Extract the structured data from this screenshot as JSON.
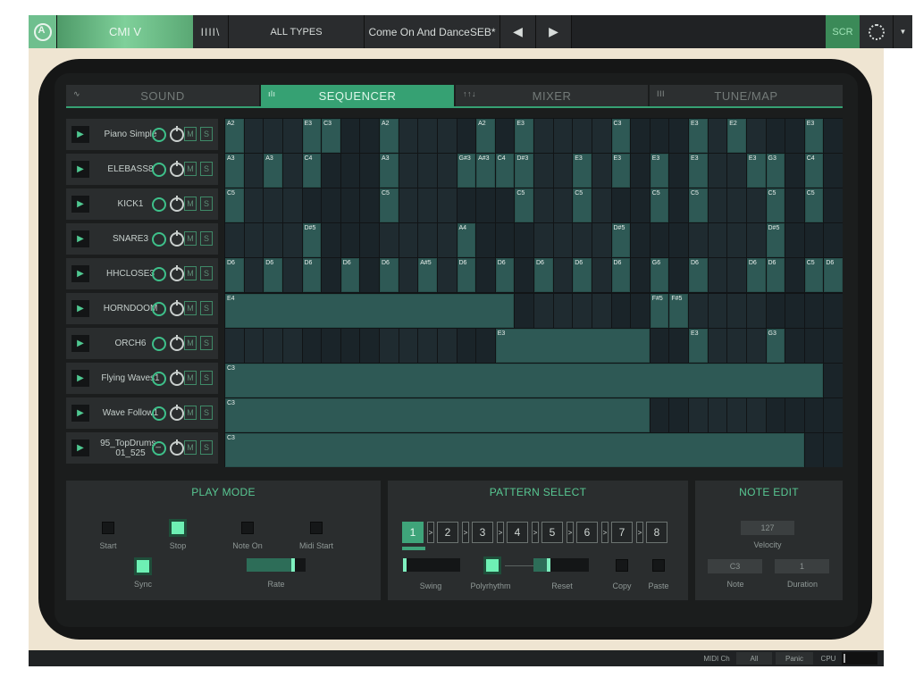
{
  "topbar": {
    "app_name": "CMI V",
    "library_icon": "IIII\\",
    "type_filter": "ALL TYPES",
    "preset_name": "Come On And DanceSEB*",
    "prev_glyph": "◀",
    "next_glyph": "▶",
    "scr_label": "SCR",
    "menu_glyph": "▼"
  },
  "tabs": [
    {
      "label": "SOUND",
      "icon": "∿"
    },
    {
      "label": "SEQUENCER",
      "icon": "ılı"
    },
    {
      "label": "MIXER",
      "icon": "↑↑↓"
    },
    {
      "label": "TUNE/MAP",
      "icon": "III"
    }
  ],
  "tracks": [
    {
      "name": "Piano Simple"
    },
    {
      "name": "ELEBASS8"
    },
    {
      "name": "KICK1"
    },
    {
      "name": "SNARE3"
    },
    {
      "name": "HHCLOSE3"
    },
    {
      "name": "HORNDOOM"
    },
    {
      "name": "ORCH6"
    },
    {
      "name": "Flying Waves1"
    },
    {
      "name": "Wave Follow1"
    },
    {
      "name": "95_TopDrums_ 01_525"
    }
  ],
  "track_controls": {
    "play_glyph": "▶",
    "mute": "M",
    "solo": "S"
  },
  "grid": {
    "steps": 32,
    "rows": [
      {
        "notes": [
          {
            "s": 0,
            "l": 1,
            "n": "A2"
          },
          {
            "s": 4,
            "l": 1,
            "n": "E3"
          },
          {
            "s": 5,
            "l": 1,
            "n": "C3"
          },
          {
            "s": 8,
            "l": 1,
            "n": "A2"
          },
          {
            "s": 13,
            "l": 1,
            "n": "A2"
          },
          {
            "s": 15,
            "l": 1,
            "n": "E3"
          },
          {
            "s": 20,
            "l": 1,
            "n": "C3"
          },
          {
            "s": 24,
            "l": 1,
            "n": "E3"
          },
          {
            "s": 26,
            "l": 1,
            "n": "E2"
          },
          {
            "s": 30,
            "l": 1,
            "n": "E3"
          }
        ]
      },
      {
        "notes": [
          {
            "s": 0,
            "l": 1,
            "n": "A3"
          },
          {
            "s": 2,
            "l": 1,
            "n": "A3"
          },
          {
            "s": 4,
            "l": 1,
            "n": "C4"
          },
          {
            "s": 8,
            "l": 1,
            "n": "A3"
          },
          {
            "s": 12,
            "l": 1,
            "n": "G#3"
          },
          {
            "s": 13,
            "l": 1,
            "n": "A#3"
          },
          {
            "s": 14,
            "l": 1,
            "n": "C4"
          },
          {
            "s": 15,
            "l": 1,
            "n": "D#3"
          },
          {
            "s": 18,
            "l": 1,
            "n": "E3"
          },
          {
            "s": 20,
            "l": 1,
            "n": "E3"
          },
          {
            "s": 22,
            "l": 1,
            "n": "E3"
          },
          {
            "s": 24,
            "l": 1,
            "n": "E3"
          },
          {
            "s": 27,
            "l": 1,
            "n": "E3"
          },
          {
            "s": 28,
            "l": 1,
            "n": "G3"
          },
          {
            "s": 30,
            "l": 1,
            "n": "C4"
          }
        ]
      },
      {
        "notes": [
          {
            "s": 0,
            "l": 1,
            "n": "C5"
          },
          {
            "s": 8,
            "l": 1,
            "n": "C5"
          },
          {
            "s": 15,
            "l": 1,
            "n": "C5"
          },
          {
            "s": 18,
            "l": 1,
            "n": "C5"
          },
          {
            "s": 22,
            "l": 1,
            "n": "C5"
          },
          {
            "s": 24,
            "l": 1,
            "n": "C5"
          },
          {
            "s": 28,
            "l": 1,
            "n": "C5"
          },
          {
            "s": 30,
            "l": 1,
            "n": "C5"
          }
        ]
      },
      {
        "notes": [
          {
            "s": 4,
            "l": 1,
            "n": "D#5"
          },
          {
            "s": 12,
            "l": 1,
            "n": "A4"
          },
          {
            "s": 20,
            "l": 1,
            "n": "D#5"
          },
          {
            "s": 28,
            "l": 1,
            "n": "D#5"
          }
        ]
      },
      {
        "notes": [
          {
            "s": 0,
            "l": 1,
            "n": "D6"
          },
          {
            "s": 2,
            "l": 1,
            "n": "D6"
          },
          {
            "s": 4,
            "l": 1,
            "n": "D6"
          },
          {
            "s": 6,
            "l": 1,
            "n": "D6"
          },
          {
            "s": 8,
            "l": 1,
            "n": "D6"
          },
          {
            "s": 10,
            "l": 1,
            "n": "A#5"
          },
          {
            "s": 12,
            "l": 1,
            "n": "D6"
          },
          {
            "s": 14,
            "l": 1,
            "n": "D6"
          },
          {
            "s": 16,
            "l": 1,
            "n": "D6"
          },
          {
            "s": 18,
            "l": 1,
            "n": "D6"
          },
          {
            "s": 20,
            "l": 1,
            "n": "D6"
          },
          {
            "s": 22,
            "l": 1,
            "n": "G6"
          },
          {
            "s": 24,
            "l": 1,
            "n": "D6"
          },
          {
            "s": 27,
            "l": 1,
            "n": "D6"
          },
          {
            "s": 28,
            "l": 1,
            "n": "D6"
          },
          {
            "s": 30,
            "l": 1,
            "n": "C5"
          },
          {
            "s": 31,
            "l": 1,
            "n": "D6"
          }
        ]
      },
      {
        "notes": [
          {
            "s": 0,
            "l": 15,
            "n": "E4"
          },
          {
            "s": 22,
            "l": 1,
            "n": "F#5"
          },
          {
            "s": 23,
            "l": 1,
            "n": "F#5"
          }
        ]
      },
      {
        "notes": [
          {
            "s": 14,
            "l": 8,
            "n": "E3"
          },
          {
            "s": 24,
            "l": 1,
            "n": "E3"
          },
          {
            "s": 28,
            "l": 1,
            "n": "G3"
          }
        ]
      },
      {
        "notes": [
          {
            "s": 0,
            "l": 31,
            "n": "C3"
          }
        ]
      },
      {
        "notes": [
          {
            "s": 0,
            "l": 22,
            "n": "C3"
          }
        ]
      },
      {
        "notes": [
          {
            "s": 0,
            "l": 30,
            "n": "C3"
          }
        ]
      }
    ]
  },
  "play_mode": {
    "title": "PLAY MODE",
    "start": "Start",
    "stop": "Stop",
    "note_on": "Note On",
    "midi_start": "Midi Start",
    "sync": "Sync",
    "rate": "Rate",
    "start_on": false,
    "stop_on": true,
    "note_on_on": false,
    "midi_start_on": false,
    "sync_on": true,
    "rate_value": 0.8
  },
  "pattern_select": {
    "title": "PATTERN SELECT",
    "patterns": [
      "1",
      "2",
      "3",
      "4",
      "5",
      "6",
      "7",
      "8"
    ],
    "active": 0,
    "chain_glyph": ">",
    "swing": "Swing",
    "polyrhythm": "Polyrhythm",
    "reset": "Reset",
    "copy": "Copy",
    "paste": "Paste",
    "swing_value": 0.0,
    "reset_value": 0.25,
    "polyrhythm_on": true
  },
  "note_edit": {
    "title": "NOTE EDIT",
    "velocity_value": "127",
    "velocity_label": "Velocity",
    "note_value": "C3",
    "note_label": "Note",
    "duration_value": "1",
    "duration_label": "Duration"
  },
  "statusbar": {
    "midi_ch_label": "MIDI Ch",
    "midi_ch_value": "All",
    "panic": "Panic",
    "cpu": "CPU"
  },
  "colors": {
    "accent": "#36a173",
    "note": "#2e5955",
    "led_on": "#6ef0b4"
  }
}
